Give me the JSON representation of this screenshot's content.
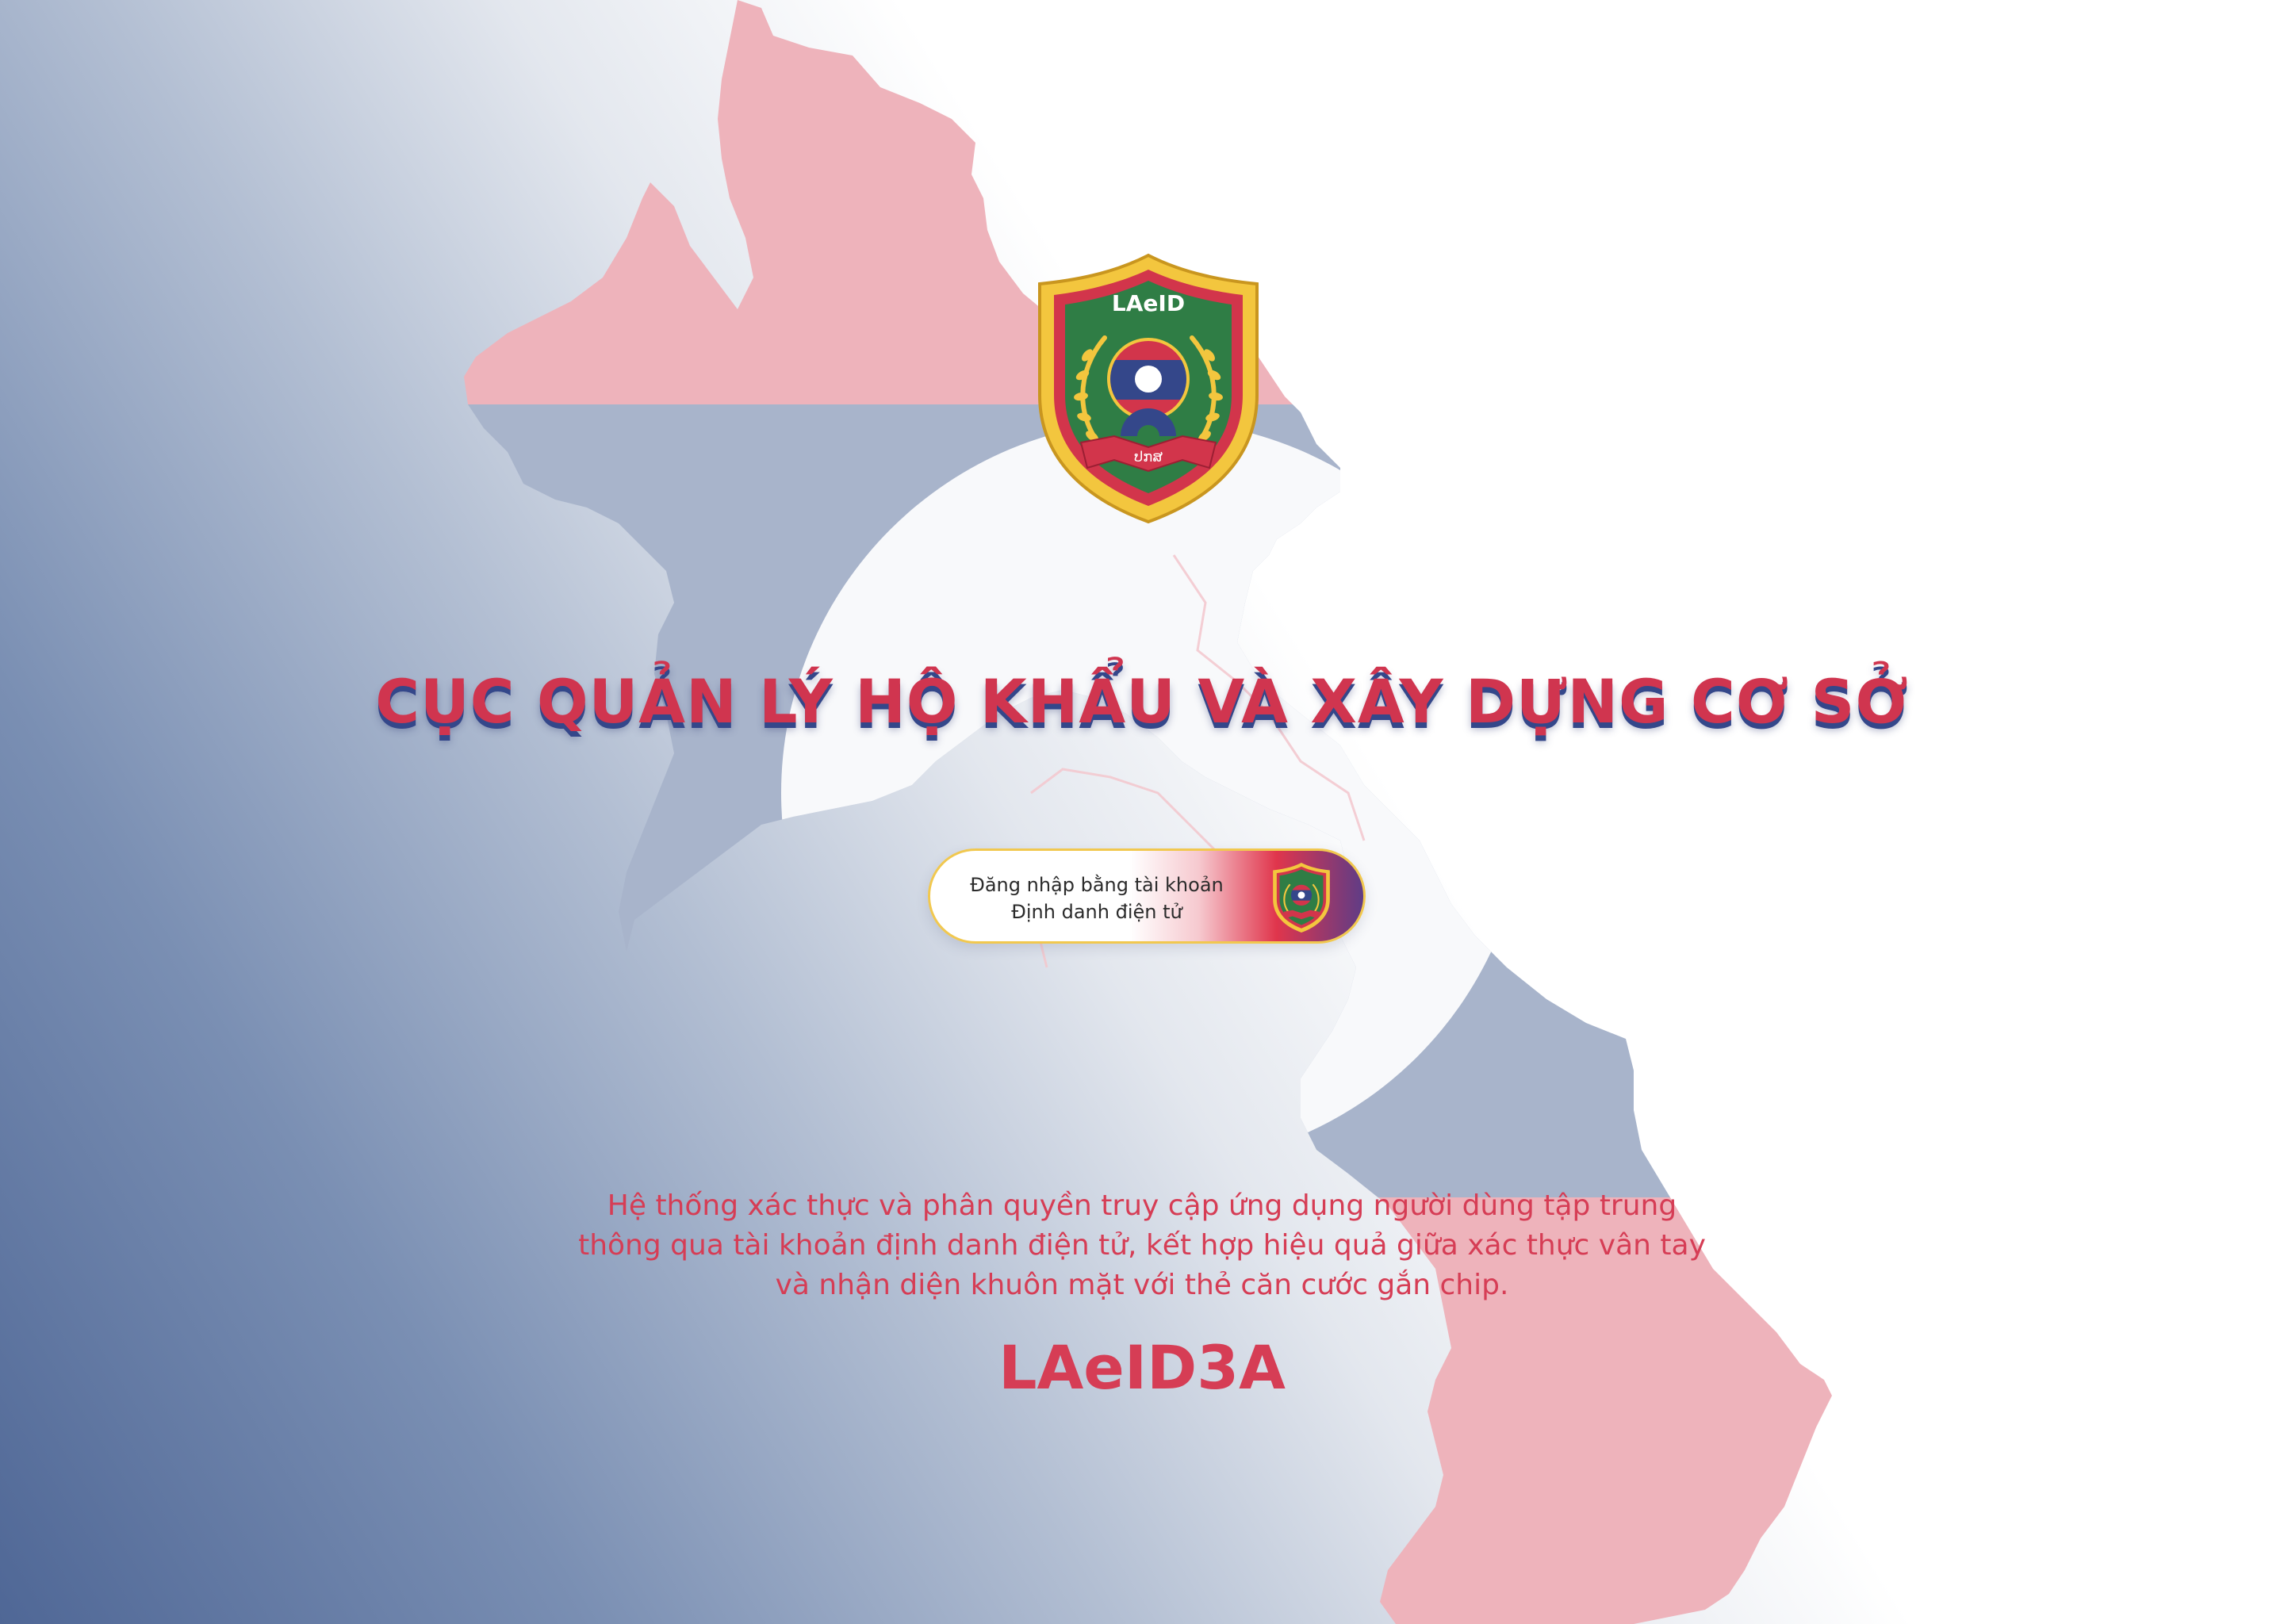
{
  "header": {
    "title": "CỤC QUẢN LÝ HỘ KHẨU VÀ XÂY DỰNG CƠ SỞ"
  },
  "logo": {
    "brand": "LAeID",
    "ribbon_text": "ປກສ",
    "icon": "laeid-emblem-icon"
  },
  "login": {
    "line1": "Đăng nhập bằng tài khoản",
    "line2": "Định danh điện tử"
  },
  "description": {
    "line1": "Hệ thống xác thực và phân quyền truy cập ứng dụng người dùng tập trung",
    "line2": "thông qua tài khoản định danh điện tử, kết hợp hiệu quả giữa xác thực vân tay",
    "line3": "và nhận diện khuôn mặt với thẻ căn cước gắn chip."
  },
  "app_name": "LAeID3A",
  "colors": {
    "accent_red": "#d63d55",
    "flag_blue": "#34478a",
    "gold": "#f1c84f",
    "emblem_green": "#2f7d45"
  }
}
